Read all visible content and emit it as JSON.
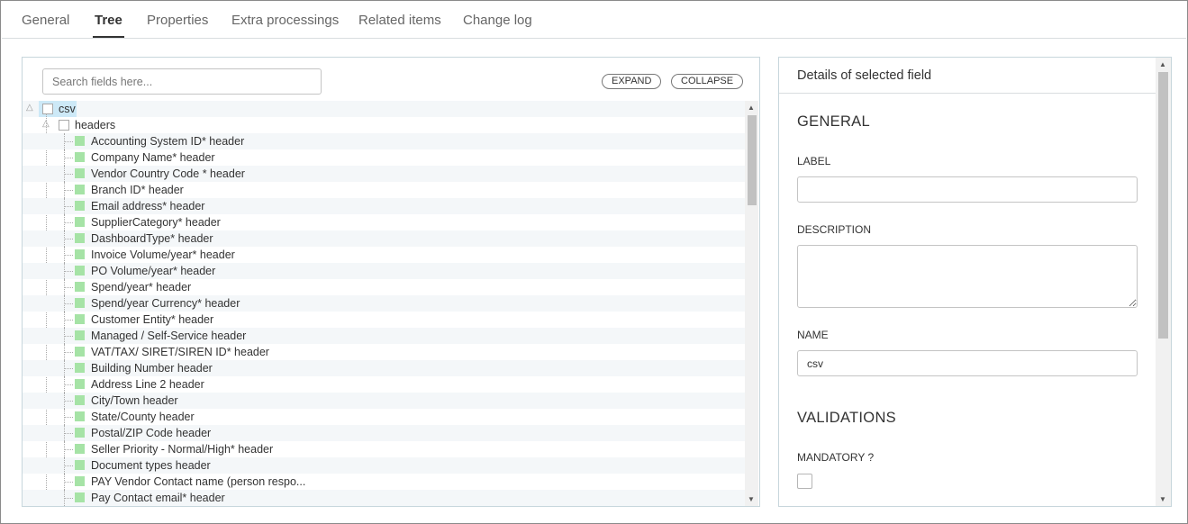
{
  "tabs": [
    {
      "label": "General",
      "active": false
    },
    {
      "label": "Tree",
      "active": true
    },
    {
      "label": "Properties",
      "active": false
    },
    {
      "label": "Extra processings",
      "active": false
    },
    {
      "label": "Related items",
      "active": false
    },
    {
      "label": "Change log",
      "active": false
    }
  ],
  "tree_panel": {
    "search_placeholder": "Search fields here...",
    "expand_label": "EXPAND",
    "collapse_label": "COLLAPSE",
    "root_label": "csv",
    "group_label": "headers",
    "items": [
      "Accounting System ID* header",
      "Company Name* header",
      "Vendor Country Code * header",
      "Branch ID* header",
      "Email address* header",
      "SupplierCategory* header",
      "DashboardType* header",
      "Invoice Volume/year* header",
      "PO Volume/year* header",
      "Spend/year* header",
      "Spend/year Currency* header",
      "Customer Entity* header",
      "Managed / Self-Service header",
      "VAT/TAX/ SIRET/SIREN ID* header",
      "Building Number header",
      "Address Line 2 header",
      "City/Town header",
      "State/County header",
      "Postal/ZIP Code header",
      "Seller Priority - Normal/High* header",
      "Document types header",
      "PAY Vendor Contact name (person respo...",
      "Pay Contact email* header"
    ]
  },
  "details": {
    "title": "Details of selected field",
    "general_title": "GENERAL",
    "label_label": "LABEL",
    "label_value": "",
    "description_label": "DESCRIPTION",
    "description_value": "",
    "name_label": "NAME",
    "name_value": "csv",
    "validations_title": "VALIDATIONS",
    "mandatory_label": "MANDATORY ?"
  },
  "colors": {
    "selected_bg": "#cde9f7",
    "leaf_icon": "#a6e3a6",
    "panel_border": "#c7d6dc"
  }
}
